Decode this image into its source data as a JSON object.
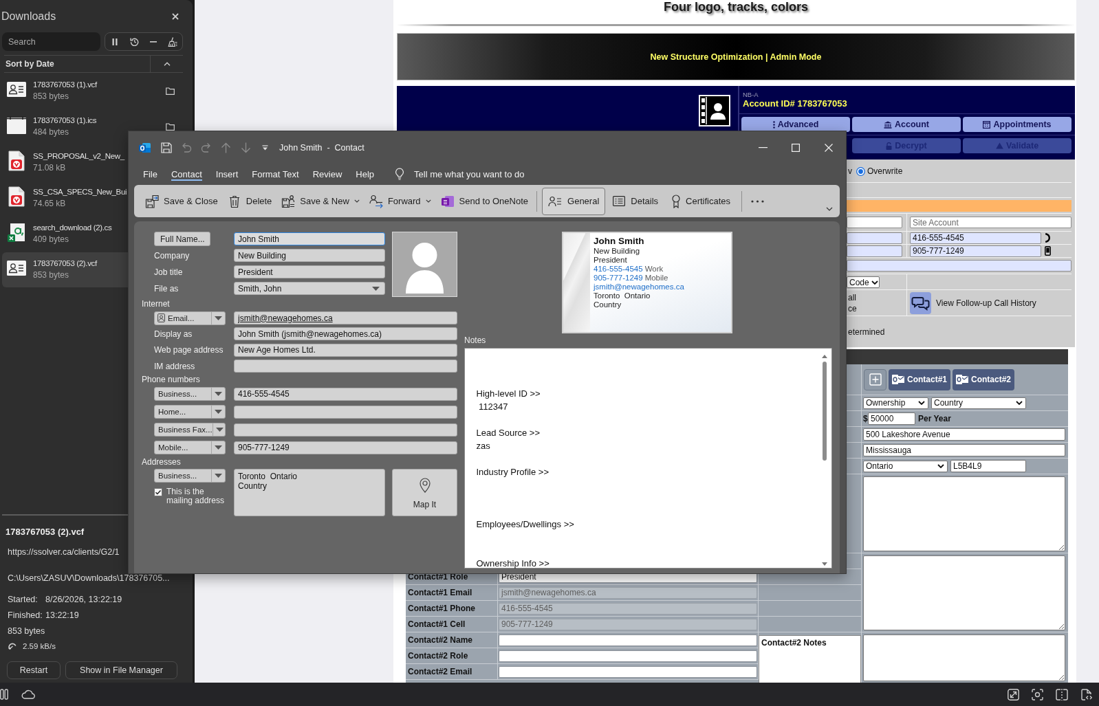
{
  "downloads_panel": {
    "title": "Downloads",
    "search": {
      "placeholder": "Search"
    },
    "sort_label": "Sort by Date",
    "items": [
      {
        "kind": "vcf",
        "name": "1783767053 (1).vcf",
        "size": "853 bytes",
        "selected": false
      },
      {
        "kind": "ics",
        "name": "1783767053 (1).ics",
        "size": "484 bytes",
        "selected": false
      },
      {
        "kind": "pdf",
        "name": "SS_PROPOSAL_v2_New_",
        "size": "71.08 kB",
        "selected": false
      },
      {
        "kind": "pdf",
        "name": "SS_CSA_SPECS_New_Bui",
        "size": "74.65 kB",
        "selected": false
      },
      {
        "kind": "csv",
        "name": "search_download (2).cs",
        "size": "409 bytes",
        "selected": false
      },
      {
        "kind": "vcf",
        "name": "1783767053 (2).vcf",
        "size": "853 bytes",
        "selected": true
      }
    ],
    "details": {
      "name": "1783767053 (2).vcf",
      "url": "https://ssolver.ca/clients/G2/1",
      "path": "C:\\Users\\ZASUV\\Downloads\\178376705...",
      "started_label": "Started:",
      "started": "8/26/2026, 13:22:19",
      "finished_label": "Finished:",
      "finished": "13:22:19",
      "size": "853 bytes",
      "speed": "2.59 kB/s"
    },
    "buttons": [
      "Restart",
      "Show in File Manager"
    ]
  },
  "web_page": {
    "heading": "Four logo, tracks, colors",
    "banner": "New Structure Optimization | Admin Mode",
    "account": {
      "code": "NB-A",
      "id": "Account ID# 1783767053"
    },
    "nav_rows": [
      [
        {
          "kind": "dots",
          "label": "Advanced",
          "disabled": false
        },
        {
          "kind": "bank",
          "label": "Account",
          "disabled": false
        },
        {
          "kind": "calendar",
          "label": "Appointments",
          "disabled": false
        }
      ],
      [
        {
          "kind": "lock",
          "label": "Decrypt",
          "disabled": true
        },
        {
          "kind": "warning",
          "label": "Validate",
          "disabled": true
        }
      ]
    ],
    "write_mode": {
      "cut_label": "v",
      "options": [
        {
          "label": "Overwrite",
          "selected": true
        }
      ]
    },
    "site_account": {
      "placeholder": "Site Account"
    },
    "phones": [
      {
        "kind": "phone",
        "value": "416-555-4545"
      },
      {
        "kind": "mobile",
        "value": "905-777-1249"
      }
    ],
    "code_select": "Code",
    "call_history": {
      "cut_lines": [
        "all",
        "ce"
      ],
      "link": "View Follow-up Call History"
    },
    "status_cut": "etermined",
    "contacts_table": {
      "buttons": [
        "Contact#1",
        "Contact#2"
      ],
      "ownership": "Ownership",
      "country": "Country",
      "currency": "$",
      "amount": "50000",
      "amount_unit": "Per Year",
      "street": "500 Lakeshore Avenue",
      "city": "Mississauga",
      "province": "Ontario",
      "postal_code": "L5B4L9",
      "rows": [
        {
          "label": "Contact#1 Role",
          "value": "President",
          "disabled": false
        },
        {
          "label": "Contact#1 Email",
          "value": "jsmith@newagehomes.ca",
          "disabled": true
        },
        {
          "label": "Contact#1 Phone",
          "value": "416-555-4545",
          "disabled": true
        },
        {
          "label": "Contact#1 Cell",
          "value": "905-777-1249",
          "disabled": true
        },
        {
          "label": "Contact#2 Name",
          "disabled": false
        },
        {
          "label": "Contact#2 Role",
          "disabled": false
        },
        {
          "label": "Contact#2 Email",
          "disabled": false
        }
      ],
      "notes_label": "Contact#2 Notes"
    }
  },
  "contact_window": {
    "title": "John Smith  -  Contact",
    "menu": [
      {
        "label": "File",
        "selected": false
      },
      {
        "label": "Contact",
        "selected": true
      },
      {
        "label": "Insert",
        "selected": false
      },
      {
        "label": "Format Text",
        "selected": false
      },
      {
        "label": "Review",
        "selected": false
      },
      {
        "label": "Help",
        "selected": false
      }
    ],
    "tell_me": {
      "placeholder": "Tell me what you want to do"
    },
    "ribbon": {
      "actions": [
        {
          "kind": "save_close",
          "label": "Save & Close",
          "dropdown": false
        },
        {
          "kind": "delete",
          "label": "Delete",
          "dropdown": false
        },
        {
          "kind": "save_new",
          "label": "Save & New",
          "dropdown": true
        },
        {
          "kind": "forward",
          "label": "Forward",
          "dropdown": true
        },
        {
          "kind": "onenote",
          "label": "Send to OneNote",
          "dropdown": false
        }
      ],
      "views": [
        {
          "kind": "general",
          "label": "General",
          "selected": true
        },
        {
          "kind": "details",
          "label": "Details",
          "selected": false
        },
        {
          "kind": "certificates",
          "label": "Certificates",
          "selected": false
        }
      ]
    },
    "form": {
      "full_name": {
        "button": "Full Name...",
        "value": "John Smith",
        "focused": true
      },
      "fields": [
        {
          "label": "Company",
          "value": "New Building"
        },
        {
          "label": "Job title",
          "value": "President"
        }
      ],
      "file_as": {
        "label": "File as",
        "value": "Smith, John"
      },
      "internet": {
        "heading": "Internet",
        "email": {
          "button": "Email...",
          "value": "jsmith@newagehomes.ca"
        },
        "fields": [
          {
            "label": "Display as",
            "value": "John Smith (jsmith@newagehomes.ca)"
          },
          {
            "label": "Web page address",
            "value": "New Age Homes Ltd."
          },
          {
            "label": "IM address"
          }
        ]
      },
      "phones": {
        "heading": "Phone numbers",
        "items": [
          {
            "type": "Business...",
            "value": "416-555-4545"
          },
          {
            "type": "Home..."
          },
          {
            "type": "Business Fax..."
          },
          {
            "type": "Mobile...",
            "value": "905-777-1249"
          }
        ]
      },
      "addresses": {
        "heading": "Addresses",
        "type": "Business...",
        "value": "Toronto  Ontario\nCountry",
        "mailing": {
          "label": "This is the mailing address",
          "checked": true
        },
        "map_button": "Map It"
      }
    },
    "business_card": {
      "name": "John Smith",
      "lines": [
        "New Building",
        "President"
      ],
      "phones": [
        {
          "number": "416-555-4545",
          "type": "Work"
        },
        {
          "number": "905-777-1249",
          "type": "Mobile"
        }
      ],
      "email": "jsmith@newagehomes.ca",
      "address": [
        "Toronto  Ontario",
        "Country"
      ]
    },
    "notes": {
      "label": "Notes",
      "text": "High-level ID >>\n 112347\n\nLead Source >>\nzas\n\nIndustry Profile >>\n\n\n\nEmployees/Dwellings >>\n\n\nOwnership Info >>"
    }
  }
}
